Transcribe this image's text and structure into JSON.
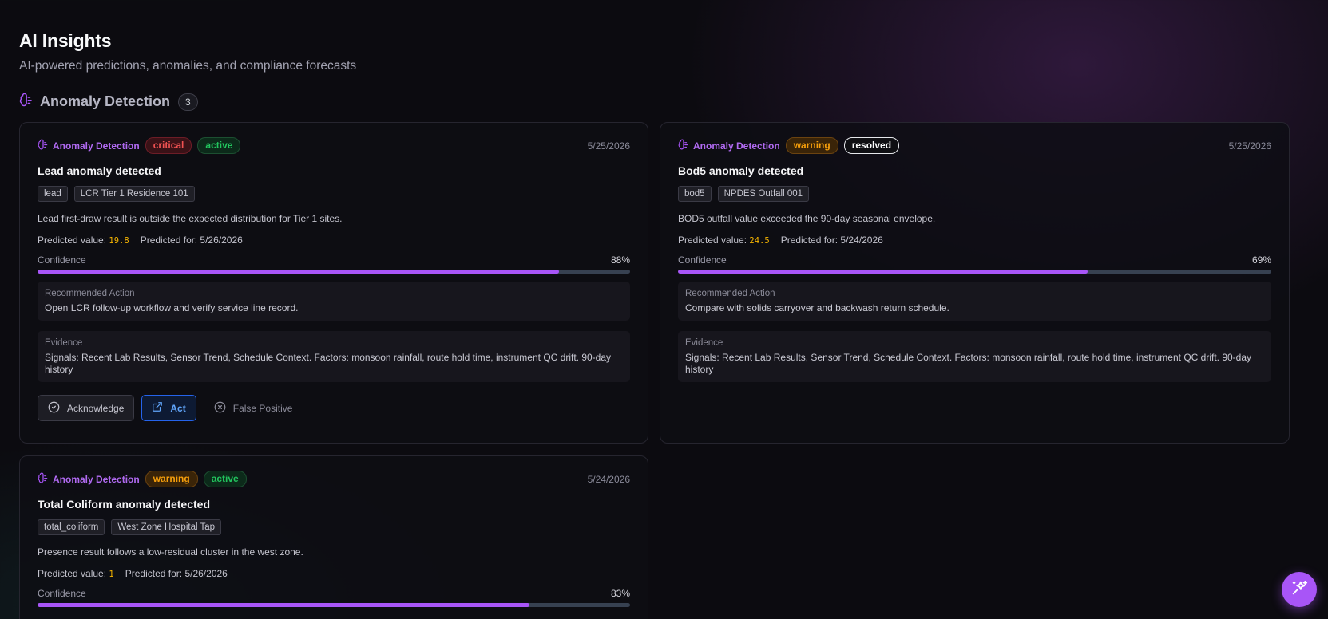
{
  "page": {
    "title": "AI Insights",
    "subtitle": "AI-powered predictions, anomalies, and compliance forecasts"
  },
  "section": {
    "title": "Anomaly Detection",
    "count": "3"
  },
  "labels": {
    "predicted_value": "Predicted value:",
    "predicted_for": "Predicted for:",
    "confidence": "Confidence",
    "recommended_action": "Recommended Action",
    "evidence": "Evidence",
    "acknowledge": "Acknowledge",
    "act": "Act",
    "false_positive": "False Positive"
  },
  "colors": {
    "accent": "#a855f7",
    "critical": "#f05252",
    "warning": "#f59e0b",
    "active": "#22c55e",
    "act_blue": "#60a5fa"
  },
  "cards": [
    {
      "type": "Anomaly Detection",
      "severity": "critical",
      "status": "active",
      "date": "5/25/2026",
      "title": "Lead anomaly detected",
      "chips": [
        "lead",
        "LCR Tier 1 Residence 101"
      ],
      "description": "Lead first-draw result is outside the expected distribution for Tier 1 sites.",
      "predicted_value": "19.8",
      "predicted_for": "5/26/2026",
      "confidence_pct": "88%",
      "confidence": 0.88,
      "recommended_action": "Open LCR follow-up workflow and verify service line record.",
      "evidence": "Signals: Recent Lab Results, Sensor Trend, Schedule Context. Factors: monsoon rainfall, route hold time, instrument QC drift. 90-day history"
    },
    {
      "type": "Anomaly Detection",
      "severity": "warning",
      "status": "resolved",
      "date": "5/25/2026",
      "title": "Bod5 anomaly detected",
      "chips": [
        "bod5",
        "NPDES Outfall 001"
      ],
      "description": "BOD5 outfall value exceeded the 90-day seasonal envelope.",
      "predicted_value": "24.5",
      "predicted_for": "5/24/2026",
      "confidence_pct": "69%",
      "confidence": 0.69,
      "recommended_action": "Compare with solids carryover and backwash return schedule.",
      "evidence": "Signals: Recent Lab Results, Sensor Trend, Schedule Context. Factors: monsoon rainfall, route hold time, instrument QC drift. 90-day history"
    },
    {
      "type": "Anomaly Detection",
      "severity": "warning",
      "status": "active",
      "date": "5/24/2026",
      "title": "Total Coliform anomaly detected",
      "chips": [
        "total_coliform",
        "West Zone Hospital Tap"
      ],
      "description": "Presence result follows a low-residual cluster in the west zone.",
      "predicted_value": "1",
      "predicted_for": "5/26/2026",
      "confidence_pct": "83%",
      "confidence": 0.83
    }
  ],
  "icons": {
    "section": "brain-icon",
    "card_type": "brain-icon",
    "acknowledge": "check-circle-icon",
    "act": "external-link-icon",
    "false_positive": "x-circle-icon",
    "fab": "sparkles-icon"
  }
}
